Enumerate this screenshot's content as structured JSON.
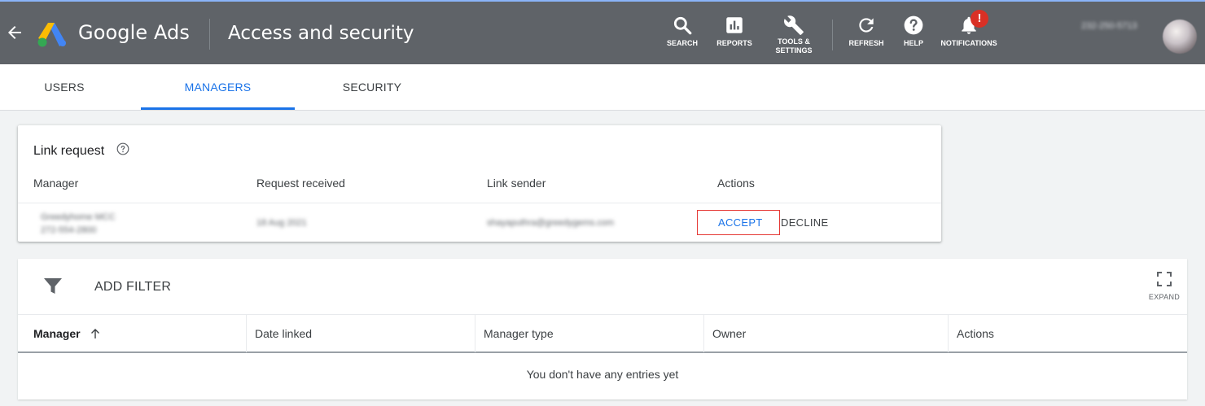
{
  "header": {
    "brand": "Google Ads",
    "page_title": "Access and security",
    "tools": [
      {
        "icon": "search-icon",
        "label": "SEARCH"
      },
      {
        "icon": "reports-icon",
        "label": "REPORTS"
      },
      {
        "icon": "wrench-icon",
        "label": "TOOLS &\nSETTINGS"
      },
      {
        "icon": "refresh-icon",
        "label": "REFRESH"
      },
      {
        "icon": "help-icon",
        "label": "HELP"
      },
      {
        "icon": "bell-icon",
        "label": "NOTIFICATIONS"
      }
    ],
    "notification_badge": "!",
    "customer_id": "232-250-5713"
  },
  "tabs": [
    {
      "label": "USERS",
      "active": false
    },
    {
      "label": "MANAGERS",
      "active": true
    },
    {
      "label": "SECURITY",
      "active": false
    }
  ],
  "link_request": {
    "title": "Link request",
    "columns": [
      "Manager",
      "Request received",
      "Link sender",
      "Actions"
    ],
    "row": {
      "manager_name": "Greedyhome MCC",
      "manager_id": "272-554-2800",
      "received": "18 Aug 2021",
      "sender": "shayaputhra@greedygems.com",
      "accept_label": "ACCEPT",
      "decline_label": "DECLINE"
    }
  },
  "managers_table": {
    "add_filter_label": "ADD FILTER",
    "expand_label": "EXPAND",
    "columns": [
      "Manager",
      "Date linked",
      "Manager type",
      "Owner",
      "Actions"
    ],
    "empty_message": "You don't have any entries yet"
  },
  "colors": {
    "header_bg": "#5f6368",
    "accent": "#1a73e8",
    "alert": "#d93025"
  }
}
